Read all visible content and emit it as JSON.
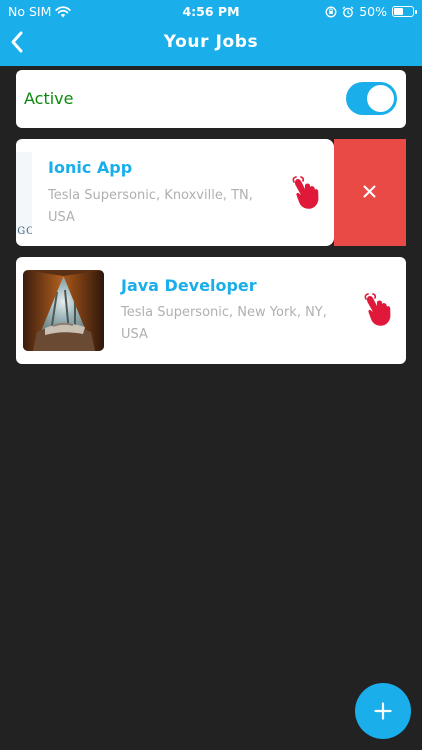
{
  "status_bar": {
    "carrier": "No SIM",
    "time": "4:56 PM",
    "battery_percent": "50%",
    "battery_level": 0.5,
    "icons": [
      "wifi-icon",
      "orientation-lock-icon",
      "alarm-icon",
      "battery-icon"
    ]
  },
  "header": {
    "title": "Your Jobs",
    "back_icon": "chevron-left-icon"
  },
  "active_toggle": {
    "label": "Active",
    "on": true
  },
  "jobs": [
    {
      "title": "Ionic App",
      "location": "Tesla Supersonic, Knoxville, TN, USA",
      "logo_text": "OGO",
      "swiped": true,
      "action_icon": "hand-tap-icon"
    },
    {
      "title": "Java Developer",
      "location": "Tesla Supersonic, New York, NY, USA",
      "image": "tent-photo",
      "swiped": false,
      "action_icon": "hand-tap-icon"
    }
  ],
  "delete_action": {
    "icon": "close-icon"
  },
  "fab": {
    "icon": "plus-icon"
  },
  "colors": {
    "primary": "#1aaeea",
    "background": "#222222",
    "card": "#ffffff",
    "active_label": "#0a8a0a",
    "delete": "#ea4a45",
    "hand_icon": "#e0193a",
    "secondary_text": "#b0b0b0"
  }
}
